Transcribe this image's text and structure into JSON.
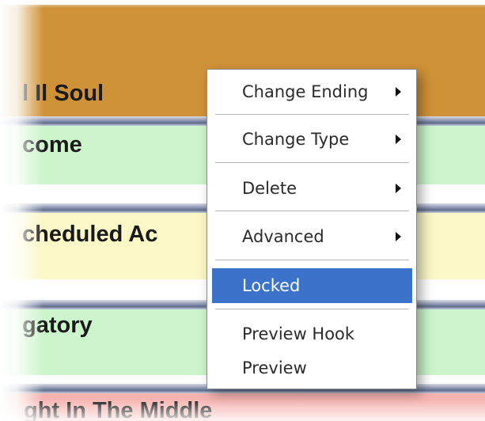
{
  "rows": [
    {
      "label": "l Il Soul",
      "color": "#cf9237"
    },
    {
      "label": "come",
      "color": "#ccf5cb"
    },
    {
      "label": "cheduled Ac",
      "color": "#fcf7c6"
    },
    {
      "label": "gatory",
      "color": "#ccf5cb"
    },
    {
      "label": "ght In The Middle",
      "color": "#f6b3b0"
    }
  ],
  "context_menu": {
    "items": [
      {
        "label": "Change Ending",
        "submenu": true,
        "selected": false
      },
      {
        "label": "Change Type",
        "submenu": true,
        "selected": false
      },
      {
        "label": "Delete",
        "submenu": true,
        "selected": false
      },
      {
        "label": "Advanced",
        "submenu": true,
        "selected": false
      },
      {
        "label": "Locked",
        "submenu": false,
        "selected": true
      },
      {
        "label": "Preview Hook",
        "submenu": false,
        "selected": false
      },
      {
        "label": "Preview",
        "submenu": false,
        "selected": false
      }
    ],
    "highlight_color": "#3a73c9"
  }
}
